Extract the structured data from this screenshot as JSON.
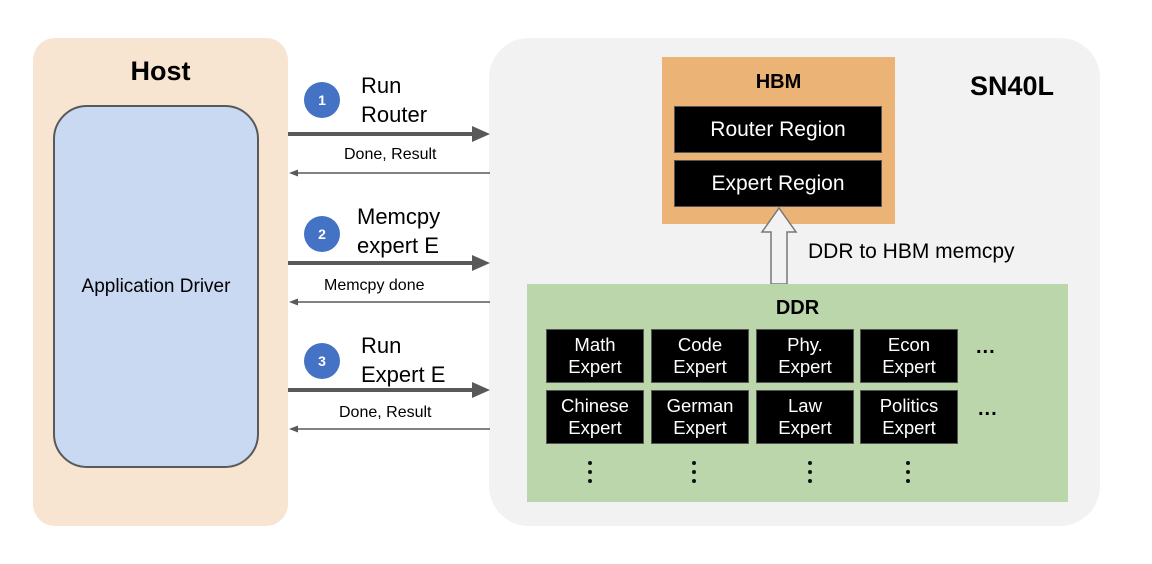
{
  "host": {
    "title": "Host",
    "driver_label": "Application Driver"
  },
  "device": {
    "title": "SN40L",
    "hbm": {
      "title": "HBM",
      "regions": [
        "Router Region",
        "Expert Region"
      ]
    },
    "ddr": {
      "title": "DDR",
      "experts": [
        [
          {
            "line1": "Math",
            "line2": "Expert"
          },
          {
            "line1": "Code",
            "line2": "Expert"
          },
          {
            "line1": "Phy.",
            "line2": "Expert"
          },
          {
            "line1": "Econ",
            "line2": "Expert"
          }
        ],
        [
          {
            "line1": "Chinese",
            "line2": "Expert"
          },
          {
            "line1": "German",
            "line2": "Expert"
          },
          {
            "line1": "Law",
            "line2": "Expert"
          },
          {
            "line1": "Politics",
            "line2": "Expert"
          }
        ]
      ],
      "row_ellipsis": "...",
      "column_ellipsis": "⋮"
    },
    "memcpy_label": "DDR to HBM memcpy"
  },
  "steps": [
    {
      "number": "1",
      "line1": "Run",
      "line2": "Router",
      "response": "Done, Result"
    },
    {
      "number": "2",
      "line1": "Memcpy",
      "line2": "expert E",
      "response": "Memcpy done"
    },
    {
      "number": "3",
      "line1": "Run",
      "line2": "Expert E",
      "response": "Done, Result"
    }
  ],
  "colors": {
    "host_bg": "#f8e5d1",
    "driver_bg": "#c9d9f2",
    "device_bg": "#f2f2f2",
    "hbm_bg": "#ecb376",
    "ddr_bg": "#bbd6aa",
    "step_badge": "#4472c4",
    "arrow": "#595959"
  }
}
